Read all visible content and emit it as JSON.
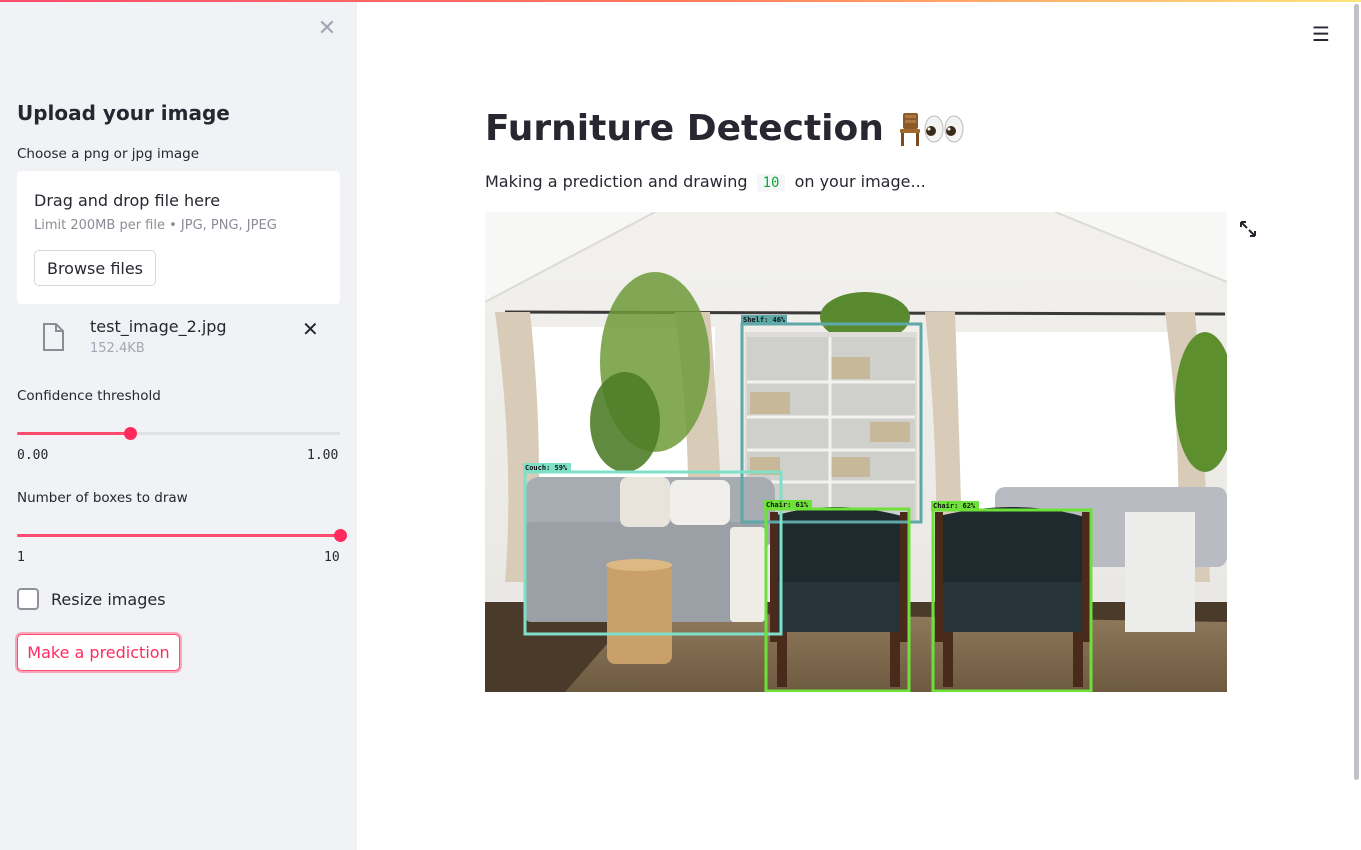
{
  "sidebar": {
    "close_glyph": "✕",
    "title": "Upload your image",
    "uploader_label": "Choose a png or jpg image",
    "dropzone_title": "Drag and drop file here",
    "dropzone_limit": "Limit 200MB per file • JPG, PNG, JPEG",
    "browse_label": "Browse files",
    "file": {
      "name": "test_image_2.jpg",
      "size": "152.4KB",
      "remove_glyph": "✕"
    },
    "confidence": {
      "label": "Confidence threshold",
      "min": "0.00",
      "max": "1.00",
      "value": 0.35
    },
    "boxes": {
      "label": "Number of boxes to draw",
      "min": "1",
      "max": "10",
      "value": 10
    },
    "resize": {
      "label": "Resize images",
      "checked": false
    },
    "predict_label": "Make a prediction"
  },
  "main": {
    "title": "Furniture Detection",
    "caption_before": "Making a prediction and drawing",
    "caption_code": "10",
    "caption_after": "on your image...",
    "detections": [
      {
        "label": "Shelf: 46%",
        "color": "#5fa8a8"
      },
      {
        "label": "Couch: 59%",
        "color": "#7fe0c8"
      },
      {
        "label": "Chair: 61%",
        "color": "#6ee03a"
      },
      {
        "label": "Chair: 62%",
        "color": "#6ee03a"
      }
    ]
  },
  "icons": {
    "menu": "hamburger-menu-icon",
    "expand": "fullscreen-icon",
    "file": "file-icon"
  },
  "colors": {
    "accent": "#ff4b6e",
    "sidebar_bg": "#f0f2f6"
  }
}
